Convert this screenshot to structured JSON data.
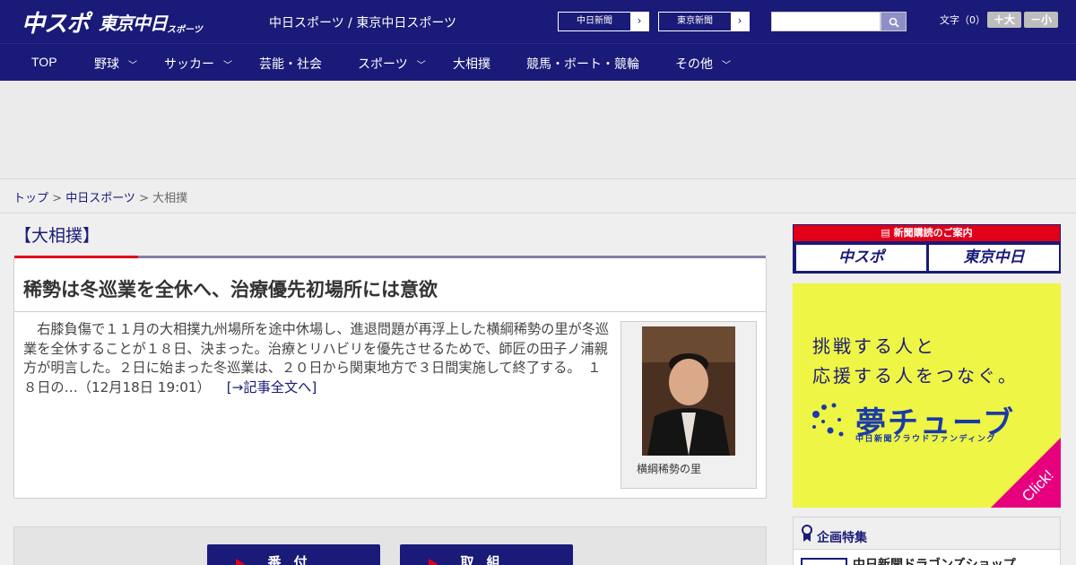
{
  "header": {
    "logo_chuspo": "中スポ",
    "logo_tokyo": "東京中日",
    "logo_tokyo_small": "スポーツ",
    "site_title": "中日スポーツ / 東京中日スポーツ",
    "link_chunichi": "中日新聞",
    "link_tokyo": "東京新聞",
    "arrow": "›",
    "search_placeholder": "",
    "font_size_label": "文字（0）",
    "font_bigger": "＋大",
    "font_smaller": "－小"
  },
  "nav": {
    "items": [
      {
        "label": "TOP",
        "dropdown": false
      },
      {
        "label": "野球",
        "dropdown": true
      },
      {
        "label": "サッカー",
        "dropdown": true
      },
      {
        "label": "芸能・社会",
        "dropdown": false
      },
      {
        "label": "スポーツ",
        "dropdown": true
      },
      {
        "label": "大相撲",
        "dropdown": false
      },
      {
        "label": "競馬・ボート・競輪",
        "dropdown": false
      },
      {
        "label": "その他",
        "dropdown": true
      }
    ],
    "chevron": "﹀"
  },
  "breadcrumb": {
    "top": "トップ",
    "sep": " > ",
    "section": "中日スポーツ",
    "current": "大相撲"
  },
  "main": {
    "section_heading": "【大相撲】",
    "article": {
      "title": "稀勢は冬巡業を全休へ、治療優先初場所には意欲",
      "body": "　右膝負傷で１１月の大相撲九州場所を途中休場し、進退問題が再浮上した横綱稀勢の里が冬巡業を全休することが１８日、決まった。治療とリハビリを優先させるためで、師匠の田子ノ浦親方が明言した。２日に始まった冬巡業は、２０日から関東地方で３日間実施して終了する。　１８日の…（12月18日 19:01）",
      "more_link": "[→記事全文へ]",
      "photo_caption": "横綱稀勢の里"
    },
    "tabs": [
      "番付",
      "取組"
    ]
  },
  "sidebar": {
    "subscribe_banner": {
      "title": "新聞購読のご案内",
      "logo_left": "中スポ",
      "logo_right": "東京中日"
    },
    "yume_ad": {
      "line1": "挑戦する人と",
      "line2": "応援する人をつなぐ。",
      "logo": "夢チューブ",
      "sub": "中日新聞クラウドファンディング",
      "click": "Click!"
    },
    "special": {
      "title": "企画特集",
      "item": "中日新聞ドラゴンズショップ"
    }
  },
  "colors": {
    "brand_navy": "#1a1a78",
    "accent_red": "#e0001a",
    "ad_yellow": "#eef545",
    "ad_magenta": "#e6007e"
  }
}
